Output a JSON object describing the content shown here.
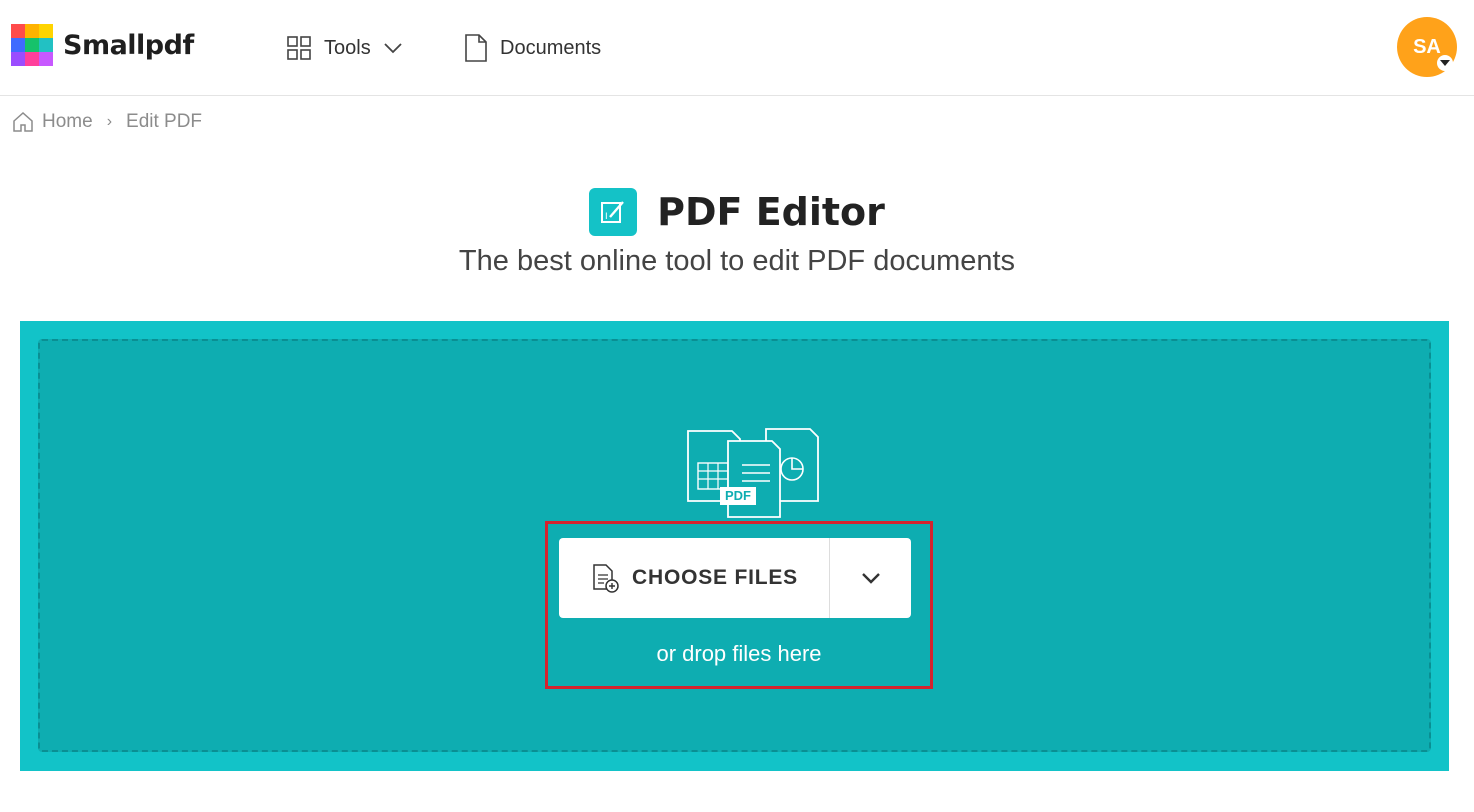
{
  "header": {
    "logo_text": "Smallpdf",
    "nav": {
      "tools_label": "Tools",
      "documents_label": "Documents"
    },
    "avatar_initials": "SA"
  },
  "breadcrumb": {
    "home_label": "Home",
    "separator": "›",
    "current_label": "Edit PDF"
  },
  "page": {
    "title": "PDF Editor",
    "subtitle": "The best online tool to edit PDF documents"
  },
  "dropzone": {
    "illustration_badge": "PDF",
    "choose_files_label": "CHOOSE FILES",
    "drop_hint": "or drop files here"
  },
  "colors": {
    "accent": "#14c2c7",
    "dropzone_inner": "#0eadb1",
    "avatar": "#ffa21a",
    "highlight": "#d3232e"
  },
  "icons": {
    "logo": "smallpdf-logo-grid",
    "tools": "grid-icon",
    "tools_caret": "chevron-down-icon",
    "documents": "document-icon",
    "home": "home-icon",
    "title": "edit-pdf-icon",
    "choose_files": "file-add-icon",
    "dropdown": "chevron-down-icon"
  }
}
